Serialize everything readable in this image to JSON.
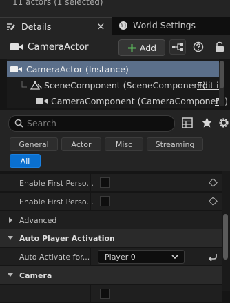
{
  "outliner_status": "11 actors (1 selected)",
  "tabs": [
    {
      "label": "Details",
      "icon": "details-icon",
      "close": "×"
    },
    {
      "label": "World Settings",
      "icon": "globe-icon"
    }
  ],
  "header": {
    "actor_name": "CameraActor",
    "actor_icon": "camera-icon",
    "add_label": "Add",
    "add_icon": "plus-icon"
  },
  "components": [
    {
      "label": "CameraActor (Instance)",
      "icon": "camera-icon",
      "selected": true
    },
    {
      "label": "SceneComponent (SceneComponent)",
      "icon": "scene-component-icon",
      "link": "Edit in"
    },
    {
      "label": "CameraComponent (CameraComponent)",
      "icon": "camera-icon",
      "link": "E"
    }
  ],
  "search": {
    "placeholder": "Search"
  },
  "filters": [
    "General",
    "Actor",
    "Misc",
    "Streaming",
    "All"
  ],
  "active_filter": "All",
  "properties": [
    {
      "label": "Enable First Perso...",
      "type": "checkbox",
      "checked": false
    },
    {
      "label": "Enable First Perso...",
      "type": "checkbox",
      "checked": false
    }
  ],
  "sections": {
    "advanced": "Advanced",
    "auto_player": "Auto Player Activation",
    "camera": "Camera"
  },
  "auto_activate": {
    "label": "Auto Activate for...",
    "value": "Player 0"
  },
  "colors": {
    "accent": "#0a70d0",
    "selected_row": "#5b6f8a",
    "add_plus": "#5ec35e"
  }
}
